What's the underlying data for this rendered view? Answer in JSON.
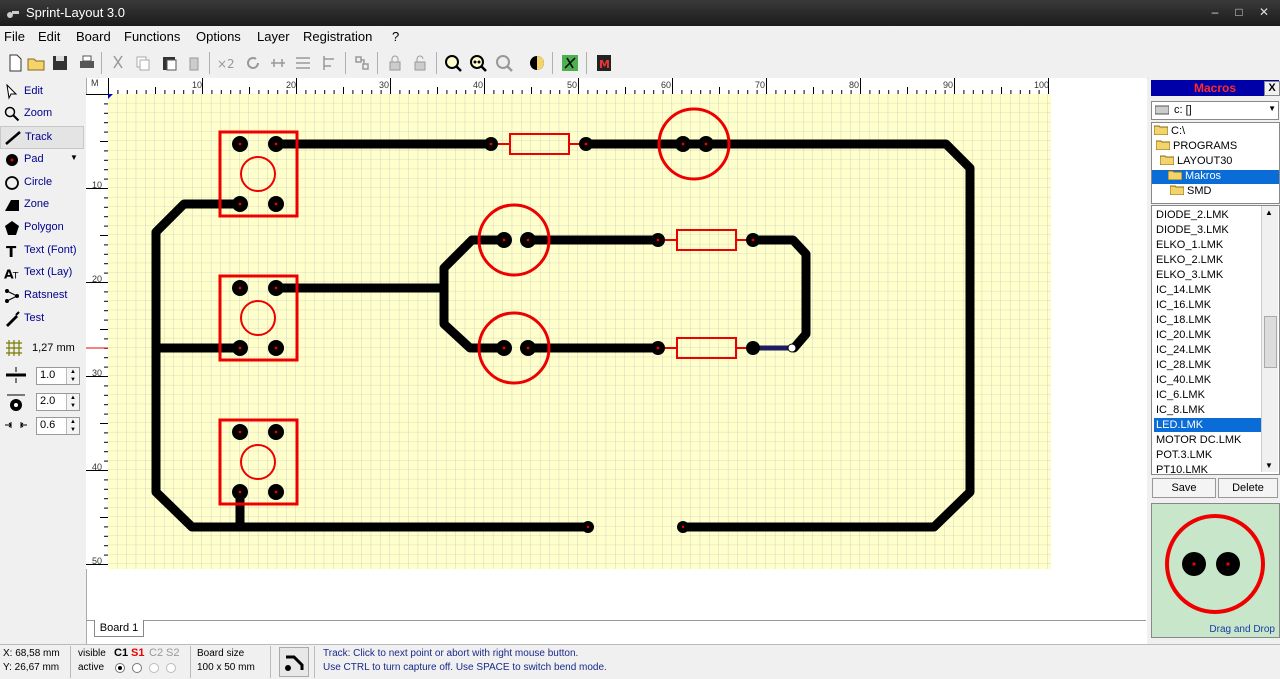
{
  "window": {
    "title": "Sprint-Layout 3.0"
  },
  "menu": [
    "File",
    "Edit",
    "Board",
    "Functions",
    "Options",
    "Layer",
    "Registration",
    "?"
  ],
  "tools": [
    {
      "label": "Edit",
      "icon": "arrow-cursor-icon"
    },
    {
      "label": "Zoom",
      "icon": "magnifier-icon"
    },
    {
      "label": "Track",
      "icon": "track-line-icon"
    },
    {
      "label": "Pad",
      "icon": "pad-dot-icon"
    },
    {
      "label": "Circle",
      "icon": "circle-icon"
    },
    {
      "label": "Zone",
      "icon": "zone-icon"
    },
    {
      "label": "Polygon",
      "icon": "polygon-icon"
    },
    {
      "label": "Text (Font)",
      "icon": "text-font-icon"
    },
    {
      "label": "Text (Lay)",
      "icon": "text-lay-icon"
    },
    {
      "label": "Ratsnest",
      "icon": "ratsnest-icon"
    },
    {
      "label": "Test",
      "icon": "test-probe-icon"
    }
  ],
  "grid": {
    "label": "1,27 mm"
  },
  "spinners": {
    "track_width": "1.0",
    "pad_size": "2.0",
    "clearance": "0.6"
  },
  "ruler": {
    "marker": "M",
    "top": [
      "10",
      "20",
      "30",
      "40",
      "50",
      "60",
      "70",
      "80",
      "90",
      "100"
    ],
    "left": [
      "10",
      "20",
      "30",
      "40",
      "50"
    ]
  },
  "board_tab": "Board 1",
  "macros": {
    "title": "Macros",
    "close": "X",
    "drive": "c: []",
    "folders": [
      "C:\\",
      "PROGRAMS",
      "LAYOUT30",
      "Makros",
      "SMD"
    ],
    "selected_folder": "Makros",
    "files": [
      "DIODE_2.LMK",
      "DIODE_3.LMK",
      "ELKO_1.LMK",
      "ELKO_2.LMK",
      "ELKO_3.LMK",
      "IC_14.LMK",
      "IC_16.LMK",
      "IC_18.LMK",
      "IC_20.LMK",
      "IC_24.LMK",
      "IC_28.LMK",
      "IC_40.LMK",
      "IC_6.LMK",
      "IC_8.LMK",
      "LED.LMK",
      "MOTOR DC.LMK",
      "POT.3.LMK",
      "PT10.LMK"
    ],
    "selected_file": "LED.LMK",
    "save": "Save",
    "delete": "Delete",
    "drag_drop": "Drag and Drop"
  },
  "status": {
    "x": "X: 68,58 mm",
    "y": "Y: 26,67 mm",
    "visible_label": "visible",
    "active_label": "active",
    "layers": [
      "C1",
      "S1",
      "C2",
      "S2"
    ],
    "board_size_label": "Board size",
    "board_size_value": "100 x 50 mm",
    "hint1": "Track: Click to next point or abort with right mouse button.",
    "hint2": "Use CTRL to turn capture off. Use SPACE to switch bend mode."
  },
  "colors": {
    "board": "#ffffcc",
    "track": "#000000",
    "silk": "#ff0000",
    "macro_title_bg": "#0000a8",
    "selection": "#0a6cd6"
  }
}
